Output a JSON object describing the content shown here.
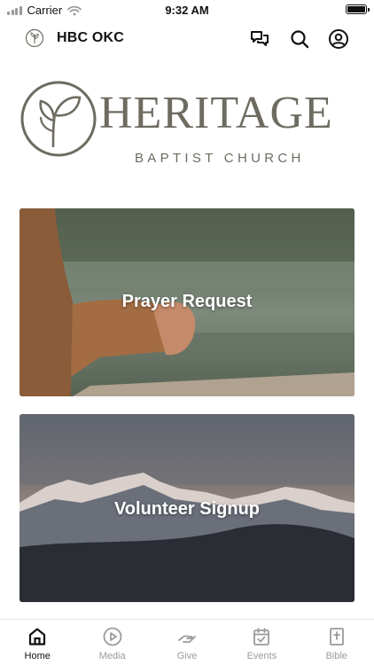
{
  "status_bar": {
    "carrier": "Carrier",
    "time": "9:32 AM",
    "icons": [
      "signal-icon",
      "wifi-icon",
      "battery-icon"
    ]
  },
  "header": {
    "title": "HBC OKC",
    "actions": [
      "chat-icon",
      "search-icon",
      "profile-icon"
    ]
  },
  "logo": {
    "word": "HERITAGE",
    "subtitle": "BAPTIST CHURCH",
    "color": "#6e6b60"
  },
  "cards": [
    {
      "label": "Prayer Request"
    },
    {
      "label": "Volunteer Signup"
    }
  ],
  "tabs": [
    {
      "label": "Home",
      "icon": "home-icon",
      "active": true
    },
    {
      "label": "Media",
      "icon": "play-icon",
      "active": false
    },
    {
      "label": "Give",
      "icon": "give-icon",
      "active": false
    },
    {
      "label": "Events",
      "icon": "calendar-icon",
      "active": false
    },
    {
      "label": "Bible",
      "icon": "bible-icon",
      "active": false
    }
  ],
  "colors": {
    "tab_active": "#111111",
    "tab_inactive": "#9b9b9b"
  }
}
